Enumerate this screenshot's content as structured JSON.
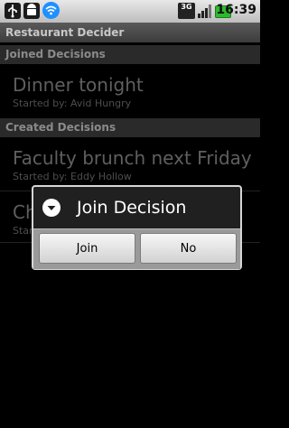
{
  "status_bar": {
    "time": "16:39",
    "network": "3G",
    "icons": [
      "usb-icon",
      "android-icon",
      "wifi-icon",
      "threeg-icon",
      "signal-icon",
      "battery-icon"
    ]
  },
  "app": {
    "title": "Restaurant Decider"
  },
  "sections": {
    "joined": {
      "header": "Joined Decisions",
      "items": [
        {
          "title": "Dinner tonight",
          "subtitle": "Started by: Avid Hungry"
        }
      ]
    },
    "created": {
      "header": "Created Decisions",
      "items": [
        {
          "title": "Faculty brunch next Friday",
          "subtitle": "Started by: Eddy Hollow"
        },
        {
          "title": "Ch",
          "subtitle": "Star"
        }
      ]
    }
  },
  "dialog": {
    "title": "Join Decision",
    "buttons": {
      "join": "Join",
      "no": "No"
    }
  },
  "colors": {
    "status_bar": "#d0d0d0",
    "title_bar": "#4a4a4a",
    "dialog_border": "#d6d6d6",
    "battery": "#2db92d",
    "wifi": "#1e90ff"
  }
}
